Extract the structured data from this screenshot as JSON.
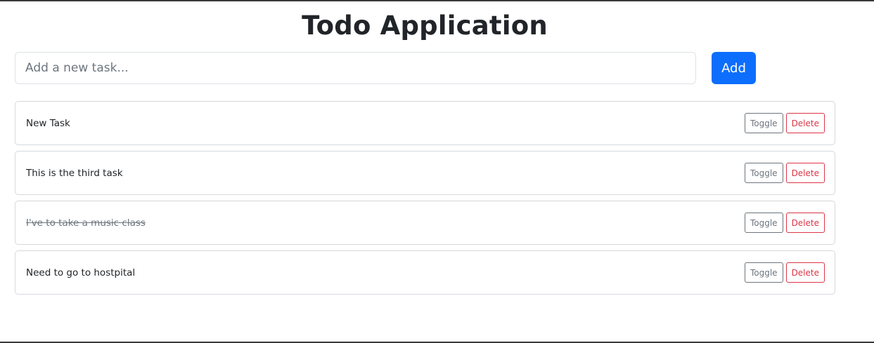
{
  "header": {
    "title": "Todo Application"
  },
  "new_task": {
    "placeholder": "Add a new task...",
    "value": "",
    "add_label": "Add"
  },
  "tasks": [
    {
      "text": "New Task",
      "completed": false,
      "toggle_label": "Toggle",
      "delete_label": "Delete"
    },
    {
      "text": "This is the third task",
      "completed": false,
      "toggle_label": "Toggle",
      "delete_label": "Delete"
    },
    {
      "text": "I've to take a music class",
      "completed": true,
      "toggle_label": "Toggle",
      "delete_label": "Delete"
    },
    {
      "text": "Need to go to hostpital",
      "completed": false,
      "toggle_label": "Toggle",
      "delete_label": "Delete"
    }
  ],
  "colors": {
    "primary": "#0d6efd",
    "secondary": "#6c757d",
    "danger": "#dc3545",
    "text": "#212529",
    "border": "#dee2e6"
  }
}
